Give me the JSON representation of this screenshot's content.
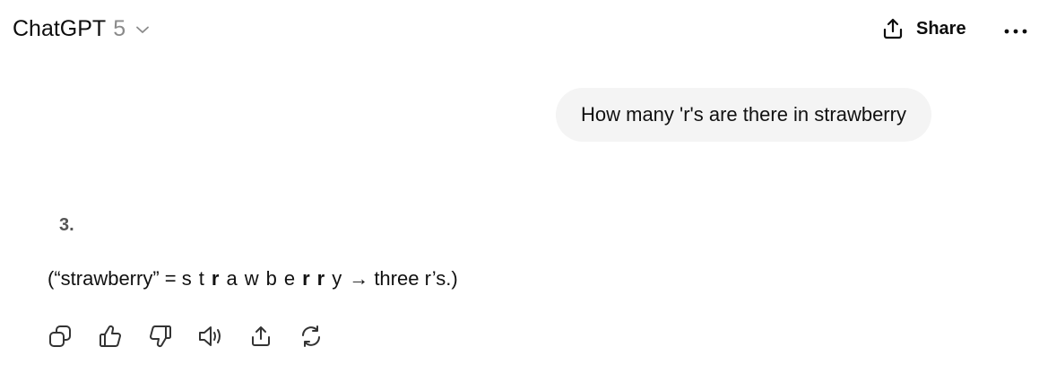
{
  "header": {
    "model_name": "ChatGPT",
    "model_version": "5",
    "share_label": "Share"
  },
  "conversation": {
    "user_message": "How many 'r's are there in strawberry",
    "assistant": {
      "heading": "3.",
      "explanation_open": "(“strawberry” = ",
      "letters": [
        "s",
        "t",
        "r",
        "a",
        "w",
        "b",
        "e",
        "r",
        "r",
        "y"
      ],
      "bold_letter_indices": [
        2,
        7,
        8
      ],
      "explanation_close": "→ three r’s.)"
    }
  },
  "actions": [
    {
      "name": "copy-icon"
    },
    {
      "name": "thumbs-up-icon"
    },
    {
      "name": "thumbs-down-icon"
    },
    {
      "name": "read-aloud-icon"
    },
    {
      "name": "share-response-icon"
    },
    {
      "name": "regenerate-icon"
    }
  ]
}
